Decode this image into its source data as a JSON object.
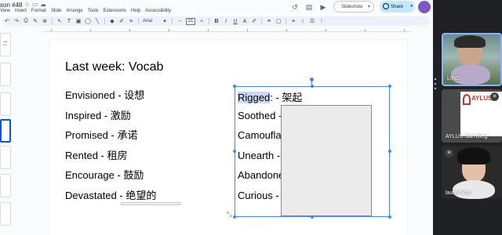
{
  "app": {
    "title": "son #48",
    "menu": [
      "View",
      "Insert",
      "Format",
      "Slide",
      "Arrange",
      "Tools",
      "Extensions",
      "Help",
      "Accessibility"
    ],
    "slideshow_label": "Slideshow",
    "share_label": "Share",
    "font_name": "Arial",
    "font_size": "21"
  },
  "slide": {
    "title": "Last week: Vocab",
    "vocab": [
      "Envisioned - 设想",
      "Inspired - 激励",
      "Promised - 承诺",
      "Rented - 租房",
      "Encourage - 鼓励",
      "Devastated - 绝望的"
    ],
    "words_box": {
      "highlighted": "Rigged",
      "lines": [
        ": - 架起",
        "Soothed -",
        "Camoufla",
        "Unearth -",
        "Abandone",
        "Curious -"
      ]
    },
    "thumb_text": "...ssic\n...ion"
  },
  "meeting": {
    "participants": [
      {
        "name": "LING"
      },
      {
        "name": "AYLUS San Dieg",
        "logo": "AYLUS"
      },
      {
        "name": "lauren kan"
      }
    ]
  }
}
